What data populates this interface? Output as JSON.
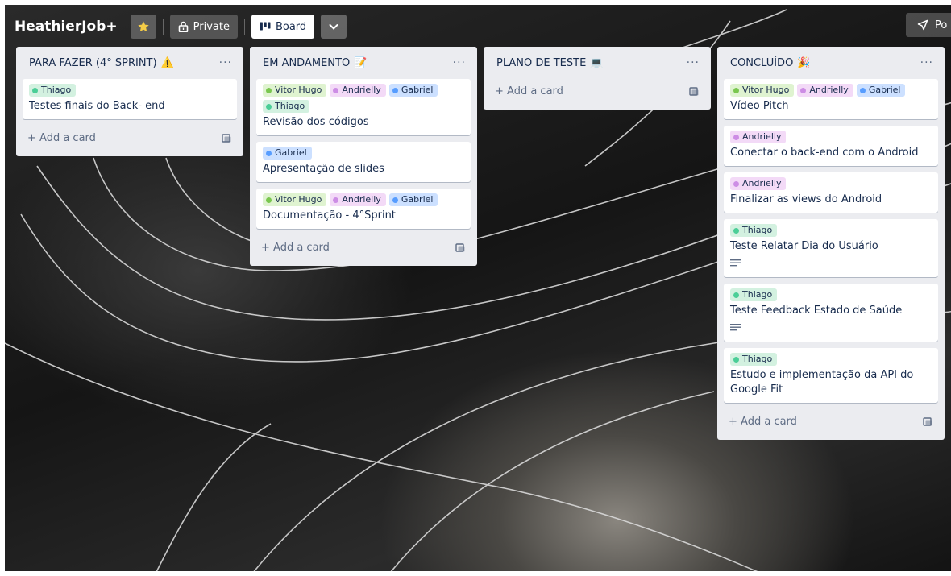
{
  "header": {
    "board_name": "HeathierJob+",
    "visibility_label": "Private",
    "view_label": "Board",
    "power_label": "Po"
  },
  "colors": {
    "label_green": "#4bce97",
    "label_lime": "#7ac74f",
    "label_purple": "#cd8de5",
    "label_blue": "#579dff",
    "list_bg": "#ebecf0",
    "star": "#f5cd47"
  },
  "add_card_label": "+ Add a card",
  "lists": [
    {
      "title": "PARA FAZER (4° SPRINT)",
      "emoji": "⚠️",
      "cards": [
        {
          "labels": [
            "Thiago"
          ],
          "title": "Testes finais do Back- end"
        }
      ]
    },
    {
      "title": "EM ANDAMENTO",
      "emoji": "📝",
      "cards": [
        {
          "labels": [
            "Vitor Hugo",
            "Andrielly",
            "Gabriel",
            "Thiago"
          ],
          "title": "Revisão dos códigos"
        },
        {
          "labels": [
            "Gabriel"
          ],
          "title": "Apresentação de slides"
        },
        {
          "labels": [
            "Vitor Hugo",
            "Andrielly",
            "Gabriel"
          ],
          "title": "Documentação - 4°Sprint"
        }
      ]
    },
    {
      "title": "PLANO DE TESTE",
      "emoji": "💻",
      "cards": []
    },
    {
      "title": "CONCLUÍDO",
      "emoji": "🎉",
      "cards": [
        {
          "labels": [
            "Vitor Hugo",
            "Andrielly",
            "Gabriel"
          ],
          "title": "Vídeo Pitch"
        },
        {
          "labels": [
            "Andrielly"
          ],
          "title": "Conectar o back-end com o Android"
        },
        {
          "labels": [
            "Andrielly"
          ],
          "title": "Finalizar as views do Android"
        },
        {
          "labels": [
            "Thiago"
          ],
          "title": "Teste Relatar Dia do Usuário",
          "has_description": true
        },
        {
          "labels": [
            "Thiago"
          ],
          "title": "Teste Feedback Estado de Saúde",
          "has_description": true
        },
        {
          "labels": [
            "Thiago"
          ],
          "title": "Estudo e implementação da API do Google Fit"
        }
      ]
    }
  ]
}
